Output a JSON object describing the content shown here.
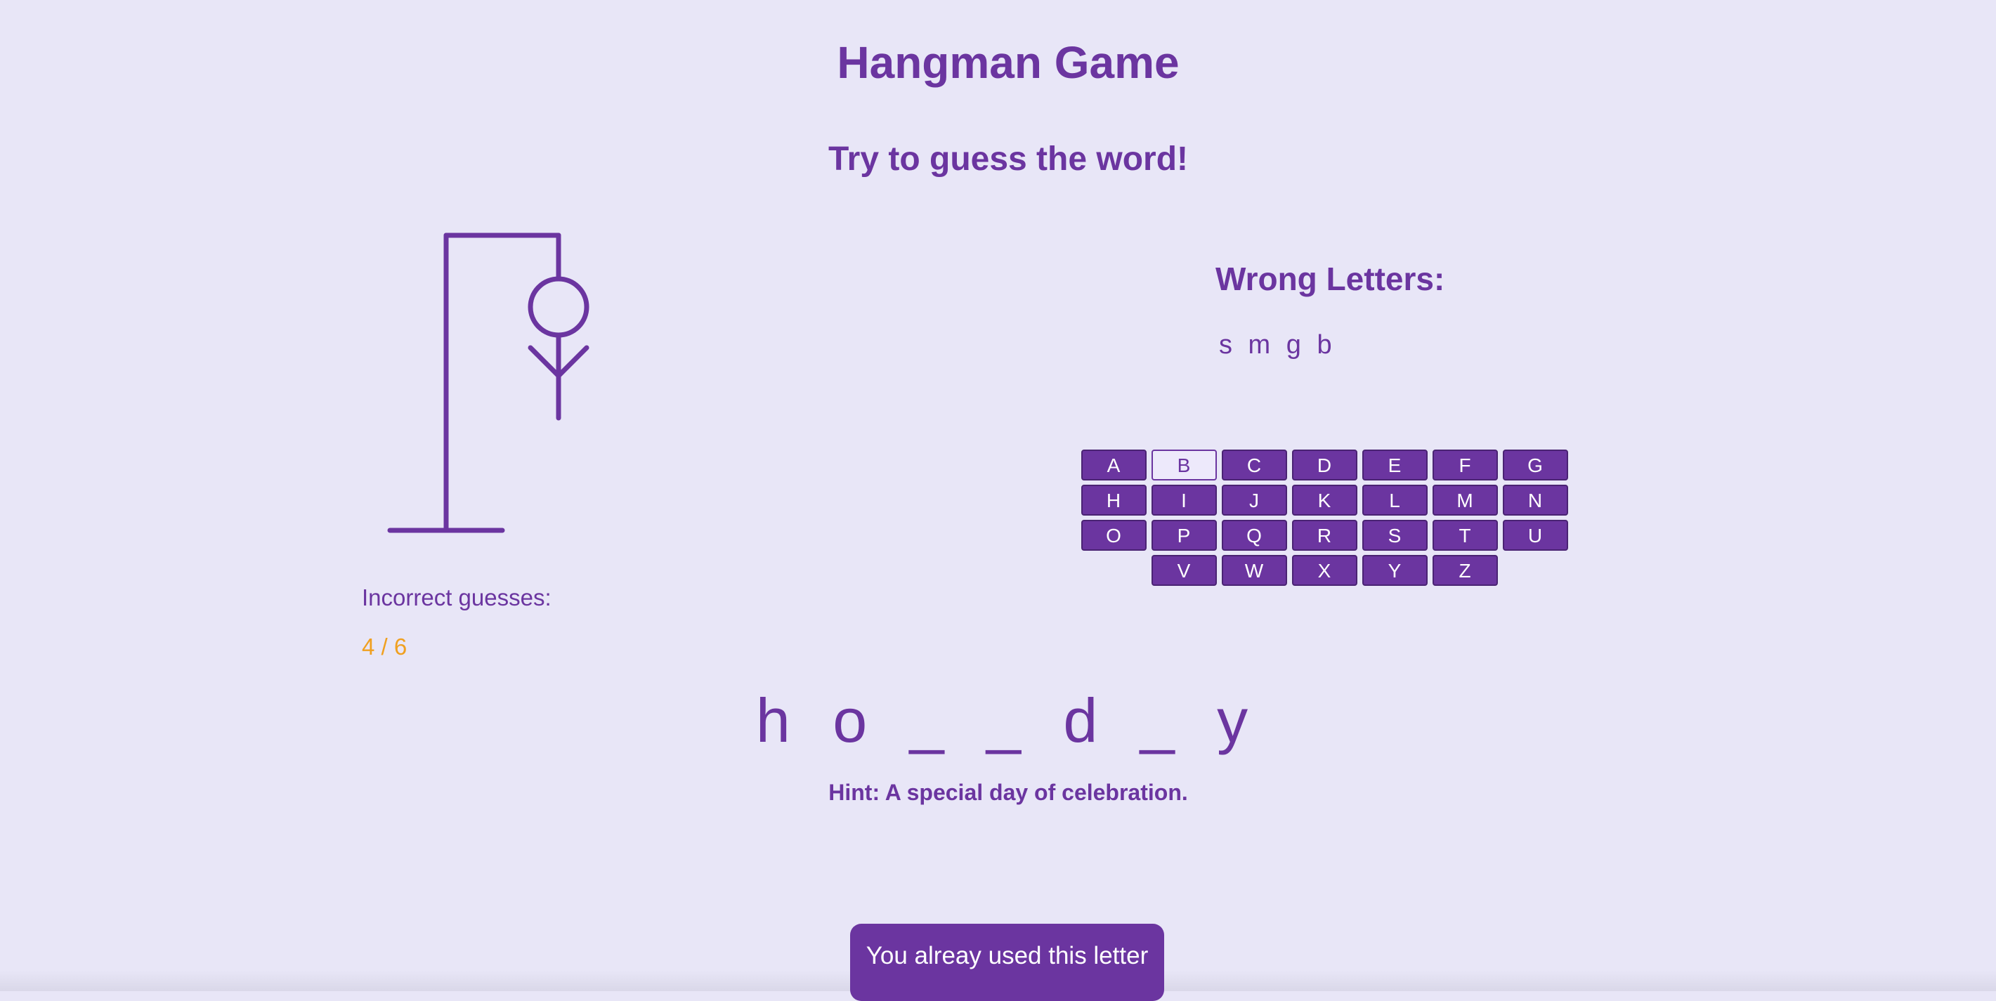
{
  "title": "Hangman Game",
  "subtitle": "Try to guess the word!",
  "stats": {
    "incorrect_label": "Incorrect guesses:",
    "incorrect_count": "4 / 6",
    "incorrect_fraction": 0.667
  },
  "wrong": {
    "heading": "Wrong Letters:",
    "letters": "s m g b"
  },
  "keyboard": {
    "rows": [
      [
        "A",
        "B",
        "C",
        "D",
        "E",
        "F",
        "G"
      ],
      [
        "H",
        "I",
        "J",
        "K",
        "L",
        "M",
        "N"
      ],
      [
        "O",
        "P",
        "Q",
        "R",
        "S",
        "T",
        "U"
      ],
      [
        "V",
        "W",
        "X",
        "Y",
        "Z"
      ]
    ],
    "used_letter": "B"
  },
  "word_display": "h o _ _ d _ y",
  "hint": "Hint: A special day of celebration.",
  "toast": "You alreay used this letter",
  "colors": {
    "background": "#e8e6f7",
    "primary": "#6b35a0",
    "accent": "#f0a020"
  },
  "icons": {
    "figure": "hangman-figure-icon"
  }
}
